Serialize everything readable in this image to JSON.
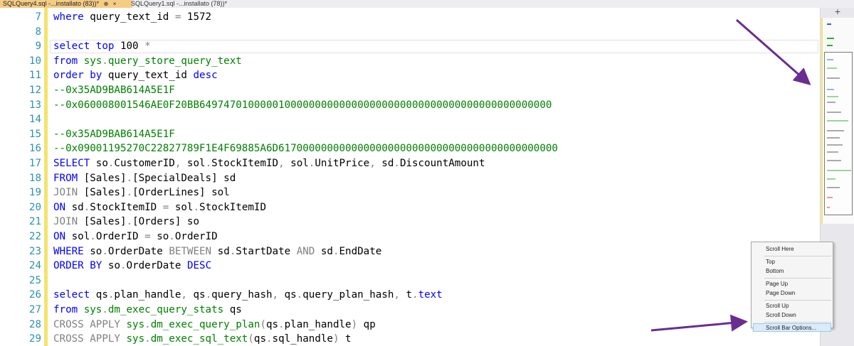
{
  "tabs": [
    {
      "label": "SQLQuery4.sql -...installato (83))*",
      "active": true,
      "pin": "⊕",
      "close": "×"
    },
    {
      "label": "SQLQuery1.sql -...installato (78))*",
      "active": false
    }
  ],
  "editor": {
    "lines": [
      {
        "n": "7",
        "tokens": [
          [
            "kw",
            "where"
          ],
          [
            "t",
            " query_text_id "
          ],
          [
            "op",
            "="
          ],
          [
            "t",
            " 1572"
          ]
        ]
      },
      {
        "n": "8",
        "tokens": []
      },
      {
        "n": "9",
        "tokens": [
          [
            "kw",
            "select"
          ],
          [
            "t",
            " "
          ],
          [
            "kw",
            "top"
          ],
          [
            "t",
            " 100 "
          ],
          [
            "op",
            "*"
          ]
        ]
      },
      {
        "n": "10",
        "tokens": [
          [
            "kw",
            "from"
          ],
          [
            "t",
            " "
          ],
          [
            "sys",
            "sys"
          ],
          [
            "op",
            "."
          ],
          [
            "sys",
            "query_store_query_text"
          ]
        ]
      },
      {
        "n": "11",
        "tokens": [
          [
            "kw",
            "order"
          ],
          [
            "t",
            " "
          ],
          [
            "kw",
            "by"
          ],
          [
            "t",
            " query_text_id "
          ],
          [
            "kw",
            "desc"
          ]
        ]
      },
      {
        "n": "12",
        "tokens": [
          [
            "cm",
            "--0x35AD9BAB614A5E1F"
          ]
        ]
      },
      {
        "n": "13",
        "tokens": [
          [
            "cm",
            "--0x060008001546AE0F20BB6497470100000100000000000000000000000000000000000000000000"
          ]
        ]
      },
      {
        "n": "14",
        "tokens": []
      },
      {
        "n": "15",
        "tokens": [
          [
            "cm",
            "--0x35AD9BAB614A5E1F"
          ]
        ]
      },
      {
        "n": "16",
        "tokens": [
          [
            "cm",
            "--0x09001195270C22827789F1E4F69885A6D6170000000000000000000000000000000000000000000"
          ]
        ]
      },
      {
        "n": "17",
        "tokens": [
          [
            "kw",
            "SELECT"
          ],
          [
            "t",
            " so"
          ],
          [
            "op",
            "."
          ],
          [
            "t",
            "CustomerID"
          ],
          [
            "op",
            ","
          ],
          [
            "t",
            " sol"
          ],
          [
            "op",
            "."
          ],
          [
            "t",
            "StockItemID"
          ],
          [
            "op",
            ","
          ],
          [
            "t",
            " sol"
          ],
          [
            "op",
            "."
          ],
          [
            "t",
            "UnitPrice"
          ],
          [
            "op",
            ","
          ],
          [
            "t",
            " sd"
          ],
          [
            "op",
            "."
          ],
          [
            "t",
            "DiscountAmount"
          ]
        ]
      },
      {
        "n": "18",
        "tokens": [
          [
            "kw",
            "FROM"
          ],
          [
            "t",
            " [Sales]"
          ],
          [
            "op",
            "."
          ],
          [
            "t",
            "[SpecialDeals] sd"
          ]
        ]
      },
      {
        "n": "19",
        "tokens": [
          [
            "op",
            "JOIN"
          ],
          [
            "t",
            " [Sales]"
          ],
          [
            "op",
            "."
          ],
          [
            "t",
            "[OrderLines] sol"
          ]
        ]
      },
      {
        "n": "20",
        "tokens": [
          [
            "kw",
            "ON"
          ],
          [
            "t",
            " sd"
          ],
          [
            "op",
            "."
          ],
          [
            "t",
            "StockItemID "
          ],
          [
            "op",
            "="
          ],
          [
            "t",
            " sol"
          ],
          [
            "op",
            "."
          ],
          [
            "t",
            "StockItemID"
          ]
        ]
      },
      {
        "n": "21",
        "tokens": [
          [
            "op",
            "JOIN"
          ],
          [
            "t",
            " [Sales]"
          ],
          [
            "op",
            "."
          ],
          [
            "t",
            "[Orders] so"
          ]
        ]
      },
      {
        "n": "22",
        "tokens": [
          [
            "kw",
            "ON"
          ],
          [
            "t",
            " sol"
          ],
          [
            "op",
            "."
          ],
          [
            "t",
            "OrderID "
          ],
          [
            "op",
            "="
          ],
          [
            "t",
            " so"
          ],
          [
            "op",
            "."
          ],
          [
            "t",
            "OrderID"
          ]
        ]
      },
      {
        "n": "23",
        "tokens": [
          [
            "kw",
            "WHERE"
          ],
          [
            "t",
            " so"
          ],
          [
            "op",
            "."
          ],
          [
            "t",
            "OrderDate "
          ],
          [
            "op",
            "BETWEEN"
          ],
          [
            "t",
            " sd"
          ],
          [
            "op",
            "."
          ],
          [
            "t",
            "StartDate "
          ],
          [
            "op",
            "AND"
          ],
          [
            "t",
            " sd"
          ],
          [
            "op",
            "."
          ],
          [
            "t",
            "EndDate"
          ]
        ]
      },
      {
        "n": "24",
        "tokens": [
          [
            "kw",
            "ORDER"
          ],
          [
            "t",
            " "
          ],
          [
            "kw",
            "BY"
          ],
          [
            "t",
            " so"
          ],
          [
            "op",
            "."
          ],
          [
            "t",
            "OrderDate "
          ],
          [
            "kw",
            "DESC"
          ]
        ]
      },
      {
        "n": "25",
        "tokens": []
      },
      {
        "n": "26",
        "tokens": [
          [
            "kw",
            "select"
          ],
          [
            "t",
            " qs"
          ],
          [
            "op",
            "."
          ],
          [
            "t",
            "plan_handle"
          ],
          [
            "op",
            ","
          ],
          [
            "t",
            " qs"
          ],
          [
            "op",
            "."
          ],
          [
            "t",
            "query_hash"
          ],
          [
            "op",
            ","
          ],
          [
            "t",
            " qs"
          ],
          [
            "op",
            "."
          ],
          [
            "t",
            "query_plan_hash"
          ],
          [
            "op",
            ","
          ],
          [
            "t",
            " t"
          ],
          [
            "op",
            "."
          ],
          [
            "kw",
            "text"
          ]
        ]
      },
      {
        "n": "27",
        "tokens": [
          [
            "kw",
            "from"
          ],
          [
            "t",
            " "
          ],
          [
            "sys",
            "sys"
          ],
          [
            "op",
            "."
          ],
          [
            "sys",
            "dm_exec_query_stats"
          ],
          [
            "t",
            " qs"
          ]
        ]
      },
      {
        "n": "28",
        "tokens": [
          [
            "op",
            "CROSS APPLY"
          ],
          [
            "t",
            " "
          ],
          [
            "sys",
            "sys"
          ],
          [
            "op",
            "."
          ],
          [
            "sys",
            "dm_exec_query_plan"
          ],
          [
            "op",
            "("
          ],
          [
            "t",
            "qs"
          ],
          [
            "op",
            "."
          ],
          [
            "t",
            "plan_handle"
          ],
          [
            "op",
            ")"
          ],
          [
            "t",
            " qp"
          ]
        ]
      },
      {
        "n": "29",
        "tokens": [
          [
            "op",
            "CROSS APPLY"
          ],
          [
            "t",
            " "
          ],
          [
            "sys",
            "sys"
          ],
          [
            "op",
            "."
          ],
          [
            "sys",
            "dm_exec_sql_text"
          ],
          [
            "op",
            "("
          ],
          [
            "t",
            "qs"
          ],
          [
            "op",
            "."
          ],
          [
            "t",
            "sql_handle"
          ],
          [
            "op",
            ")"
          ],
          [
            "t",
            " t"
          ]
        ]
      }
    ]
  },
  "scrollbar": {
    "button_glyph": "+"
  },
  "context_menu": {
    "items": [
      {
        "label": "Scroll Here"
      },
      {
        "sep": true
      },
      {
        "label": "Top"
      },
      {
        "label": "Bottom"
      },
      {
        "sep": true
      },
      {
        "label": "Page Up"
      },
      {
        "label": "Page Down"
      },
      {
        "sep": true
      },
      {
        "label": "Scroll Up"
      },
      {
        "label": "Scroll Down"
      },
      {
        "sep": true
      },
      {
        "label": "Scroll Bar Options...",
        "highlighted": true
      }
    ]
  },
  "colors": {
    "keyword": "#0000ff",
    "system": "#008000",
    "comment": "#008000",
    "operator": "#808080",
    "line_number": "#2b91af",
    "annotation_arrow": "#6a2d91",
    "tab_active": "#f5cc84"
  }
}
